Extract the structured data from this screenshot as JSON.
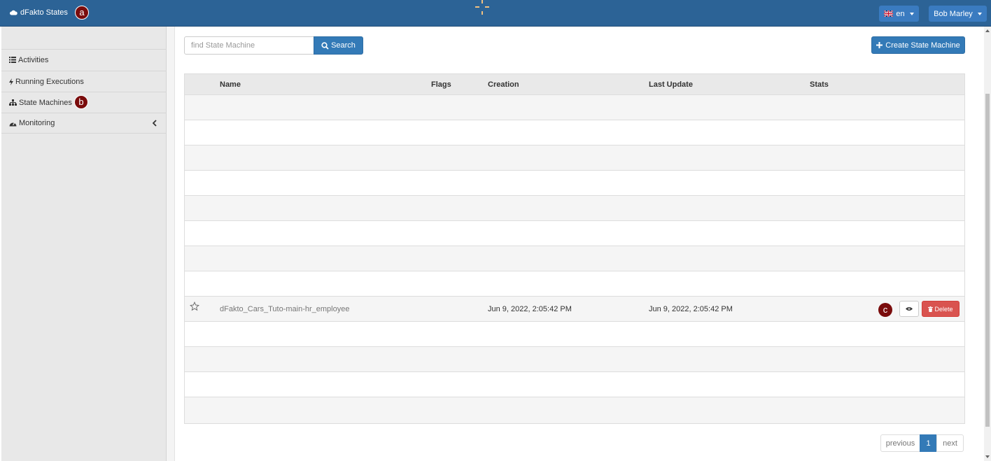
{
  "header": {
    "brand": "dFakto States",
    "marker_a": "a",
    "language": "en",
    "user": "Bob Marley"
  },
  "sidebar": {
    "items": [
      {
        "label": "Activities",
        "icon": "list-icon"
      },
      {
        "label": "Running Executions",
        "icon": "bolt-icon"
      },
      {
        "label": "State Machines",
        "icon": "sitemap-icon"
      },
      {
        "label": "Monitoring",
        "icon": "dashboard-icon"
      }
    ],
    "marker_b": "b"
  },
  "search": {
    "placeholder": "find State Machine",
    "button_label": "Search"
  },
  "create_button_label": "Create State Machine",
  "table": {
    "columns": [
      "Name",
      "Flags",
      "Creation",
      "Last Update",
      "Stats"
    ],
    "rows": [
      {
        "name": "dFakto_Cars_Tuto-main-hr_employee",
        "flags": "",
        "creation": "Jun 9, 2022, 2:05:42 PM",
        "last_update": "Jun 9, 2022, 2:05:42 PM",
        "stats": ""
      }
    ],
    "marker_c": "c",
    "delete_label": "Delete"
  },
  "pagination": {
    "previous": "previous",
    "current": "1",
    "next": "next"
  },
  "colors": {
    "topbar": "#2c6396",
    "primary": "#337ab7",
    "danger": "#d9534f",
    "marker": "#7a0c0c"
  }
}
